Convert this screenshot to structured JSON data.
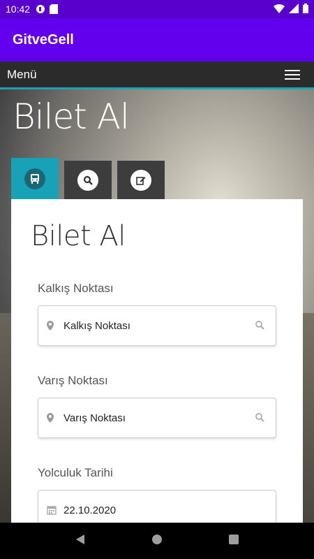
{
  "status_bar": {
    "time": "10:42"
  },
  "app_bar": {
    "title": "GitveGell"
  },
  "menu": {
    "label": "Menü"
  },
  "hero": {
    "title": "Bilet Al"
  },
  "tabs": [
    {
      "icon": "bus-icon",
      "active": true
    },
    {
      "icon": "search-icon",
      "active": false
    },
    {
      "icon": "edit-icon",
      "active": false
    }
  ],
  "card": {
    "title": "Bilet Al",
    "departure": {
      "label": "Kalkış Noktası",
      "placeholder": "Kalkış Noktası"
    },
    "arrival": {
      "label": "Varış Noktası",
      "placeholder": "Varış Noktası"
    },
    "date": {
      "label": "Yolculuk Tarihi",
      "value": "22.10.2020"
    }
  },
  "colors": {
    "status_bar": "#5a00cc",
    "app_bar": "#6200ee",
    "accent": "#17a2b8",
    "menu_bar": "#2b2b2b"
  }
}
